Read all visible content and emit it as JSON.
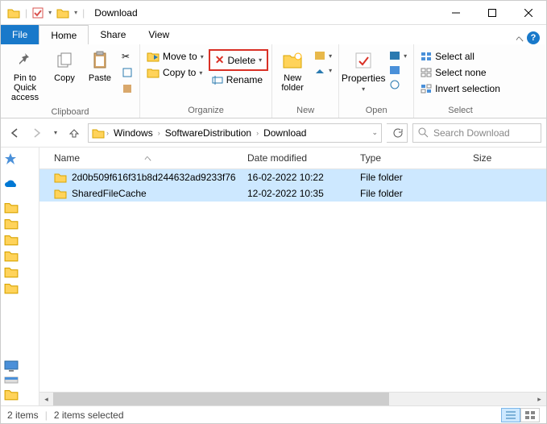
{
  "window": {
    "title": "Download"
  },
  "tabs": {
    "file": "File",
    "home": "Home",
    "share": "Share",
    "view": "View"
  },
  "ribbon": {
    "clipboard": {
      "label": "Clipboard",
      "pin": "Pin to Quick\naccess",
      "copy": "Copy",
      "paste": "Paste"
    },
    "organize": {
      "label": "Organize",
      "moveto": "Move to",
      "copyto": "Copy to",
      "delete": "Delete",
      "rename": "Rename"
    },
    "new": {
      "label": "New",
      "newfolder": "New\nfolder"
    },
    "open": {
      "label": "Open",
      "properties": "Properties"
    },
    "select": {
      "label": "Select",
      "all": "Select all",
      "none": "Select none",
      "invert": "Invert selection"
    }
  },
  "breadcrumb": [
    "Windows",
    "SoftwareDistribution",
    "Download"
  ],
  "search": {
    "placeholder": "Search Download"
  },
  "columns": {
    "name": "Name",
    "date": "Date modified",
    "type": "Type",
    "size": "Size"
  },
  "rows": [
    {
      "name": "2d0b509f616f31b8d244632ad9233f76",
      "date": "16-02-2022 10:22",
      "type": "File folder"
    },
    {
      "name": "SharedFileCache",
      "date": "12-02-2022 10:35",
      "type": "File folder"
    }
  ],
  "status": {
    "items": "2 items",
    "selected": "2 items selected"
  }
}
